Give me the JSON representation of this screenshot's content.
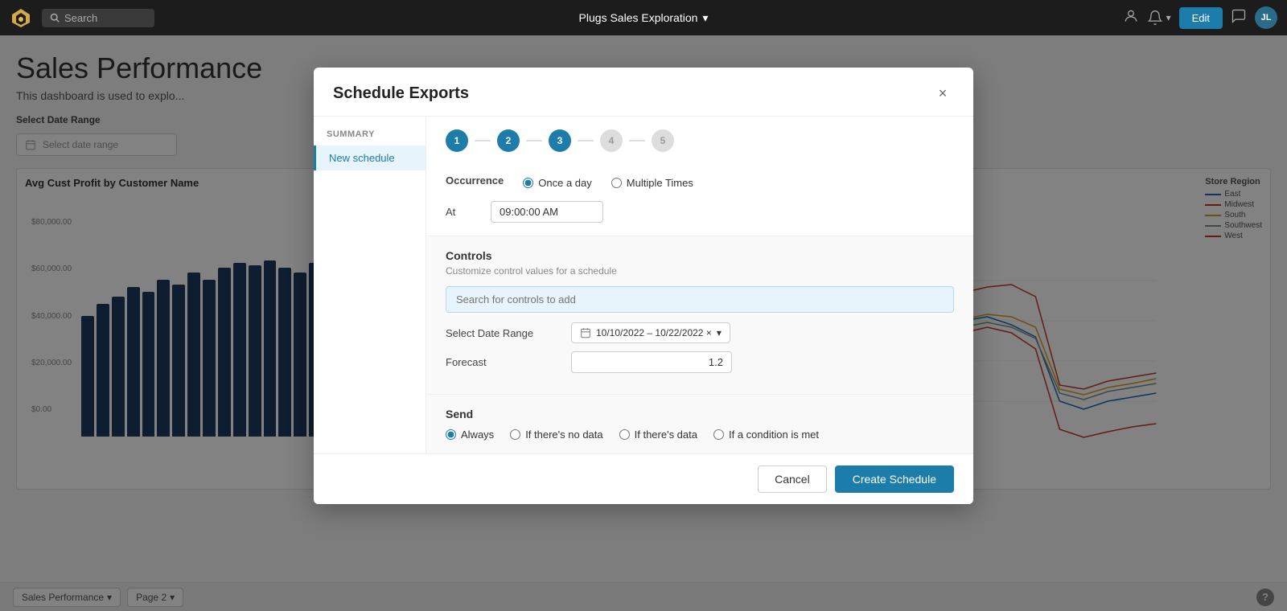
{
  "topnav": {
    "search_placeholder": "Search",
    "center_title": "Plugs Sales Exploration",
    "center_arrow": "▾",
    "edit_label": "Edit",
    "avatar_text": "JL"
  },
  "dashboard": {
    "title": "Sales Performance",
    "subtitle": "This dashboard is used to explo...",
    "date_label": "Select Date Range",
    "date_placeholder": "Select date range",
    "chart_left_title": "Avg Cust Profit by Customer Name",
    "chart_right_title": "tore Region",
    "y_axis_labels": [
      "$80,000.00",
      "$60,000.00",
      "$40,000.00",
      "$20,000.00",
      "$0.00"
    ],
    "legend": [
      {
        "name": "East",
        "color": "#1a6bb5"
      },
      {
        "name": "Midwest",
        "color": "#c0392b"
      },
      {
        "name": "South",
        "color": "#d4a017"
      },
      {
        "name": "Southwest",
        "color": "#7f8c8d"
      },
      {
        "name": "West",
        "color": "#c0392b"
      }
    ],
    "bottom_tab1": "Sales Performance",
    "bottom_tab2": "Page 2"
  },
  "modal": {
    "title": "Schedule Exports",
    "close_label": "×",
    "sidebar": {
      "section_label": "Summary",
      "item_label": "New schedule"
    },
    "steps": [
      {
        "label": "1",
        "state": "completed"
      },
      {
        "label": "2",
        "state": "completed"
      },
      {
        "label": "3",
        "state": "active"
      },
      {
        "label": "4",
        "state": "inactive"
      },
      {
        "label": "5",
        "state": "inactive"
      }
    ],
    "occurrence": {
      "label": "Occurrence",
      "option1": "Once a day",
      "option2": "Multiple Times",
      "at_label": "At",
      "time_value": "09:00:00 AM"
    },
    "controls": {
      "title": "Controls",
      "subtitle": "Customize control values for a schedule",
      "search_placeholder": "Search for controls to add",
      "date_range_label": "Select Date Range",
      "date_range_value": "10/10/2022 – 10/22/2022 ×",
      "forecast_label": "Forecast",
      "forecast_value": "1.2"
    },
    "send": {
      "title": "Send",
      "options": [
        {
          "label": "Always",
          "selected": true
        },
        {
          "label": "If there's no data",
          "selected": false
        },
        {
          "label": "If there's data",
          "selected": false
        },
        {
          "label": "If a condition is met",
          "selected": false
        }
      ]
    },
    "footer": {
      "cancel_label": "Cancel",
      "create_label": "Create Schedule"
    }
  }
}
